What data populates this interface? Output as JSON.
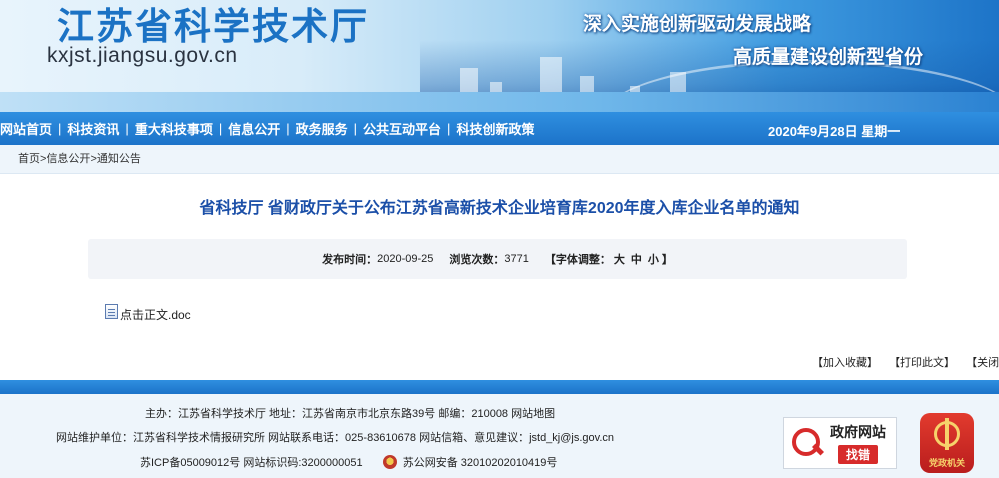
{
  "header": {
    "site_title": "江苏省科学技术厅",
    "domain": "kxjst.jiangsu.gov.cn",
    "slogan_1": "深入实施创新驱动发展战略",
    "slogan_2": "高质量建设创新型省份"
  },
  "nav": {
    "items": [
      "网站首页",
      "科技资讯",
      "重大科技事项",
      "信息公开",
      "政务服务",
      "公共互动平台",
      "科技创新政策"
    ],
    "separator": "|",
    "date": "2020年9月28日 星期一"
  },
  "breadcrumb": [
    "首页",
    "信息公开",
    "通知公告"
  ],
  "breadcrumb_sep": ">",
  "article": {
    "title": "省科技厅 省财政厅关于公布江苏省高新技术企业培育库2020年度入库企业名单的通知",
    "publish_label": "发布时间：",
    "publish_date": "2020-09-25",
    "views_label": "浏览次数：",
    "views": "3771",
    "font_label": "【字体调整：",
    "font_sizes": [
      "大",
      "中",
      "小"
    ],
    "font_close": "】",
    "attachment": "点击正文.doc"
  },
  "actions": [
    "【加入收藏】",
    "【打印此文】",
    "【关闭】"
  ],
  "footer": {
    "line1": "主办：江苏省科学技术厅  地址：江苏省南京市北京东路39号  邮编：210008  网站地图",
    "line2": "网站维护单位：江苏省科学技术情报研究所  网站联系电话：025-83610678  网站信箱、意见建议：jstd_kj@js.gov.cn",
    "icp": "苏ICP备05009012号  网站标识码:3200000051",
    "police": "苏公网安备 32010202010419号",
    "gov_badge_title": "政府网站",
    "gov_badge_action": "找错",
    "party_badge": "党政机关"
  },
  "colors": {
    "nav_blue": "#1c73c9",
    "title_blue": "#1b4fa8",
    "badge_red": "#d72b2b"
  }
}
